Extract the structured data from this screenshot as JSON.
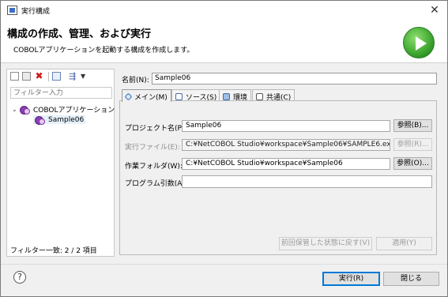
{
  "window": {
    "title": "実行構成"
  },
  "header": {
    "title": "構成の作成、管理、および実行",
    "subtitle": "COBOLアプリケーションを起動する構成を作成します。"
  },
  "left": {
    "filter_placeholder": "フィルター入力",
    "tree": [
      {
        "label": "COBOLアプリケーション",
        "expanded": true
      },
      {
        "label": "Sample06",
        "selected": true
      }
    ],
    "status": "フィルター一致: 2 / 2 項目"
  },
  "name": {
    "label": "名前(N):",
    "value": "Sample06"
  },
  "tabs": [
    {
      "label": "メイン(M)",
      "icon": "main-tab-icon",
      "active": true
    },
    {
      "label": "ソース(S)",
      "icon": "source-tab-icon"
    },
    {
      "label": "環境",
      "icon": "environment-tab-icon"
    },
    {
      "label": "共通(C)",
      "icon": "common-tab-icon"
    }
  ],
  "main": {
    "project": {
      "label": "プロジェクト名(P):",
      "value": "Sample06",
      "browse": "参照(B)..."
    },
    "exe": {
      "label": "実行ファイル(E):",
      "value": "C:¥NetCOBOL Studio¥workspace¥Sample06¥SAMPLE6.exe",
      "browse": "参照(R)..."
    },
    "workdir": {
      "label": "作業フォルダ(W):",
      "value": "C:¥NetCOBOL Studio¥workspace¥Sample06",
      "browse": "参照(O)..."
    },
    "args": {
      "label": "プログラム引数(A):",
      "value": ""
    },
    "revert": "前回保管した状態に戻す(V)",
    "apply": "適用(Y)"
  },
  "footer": {
    "help": "?",
    "run": "実行(R)",
    "close": "閉じる"
  }
}
